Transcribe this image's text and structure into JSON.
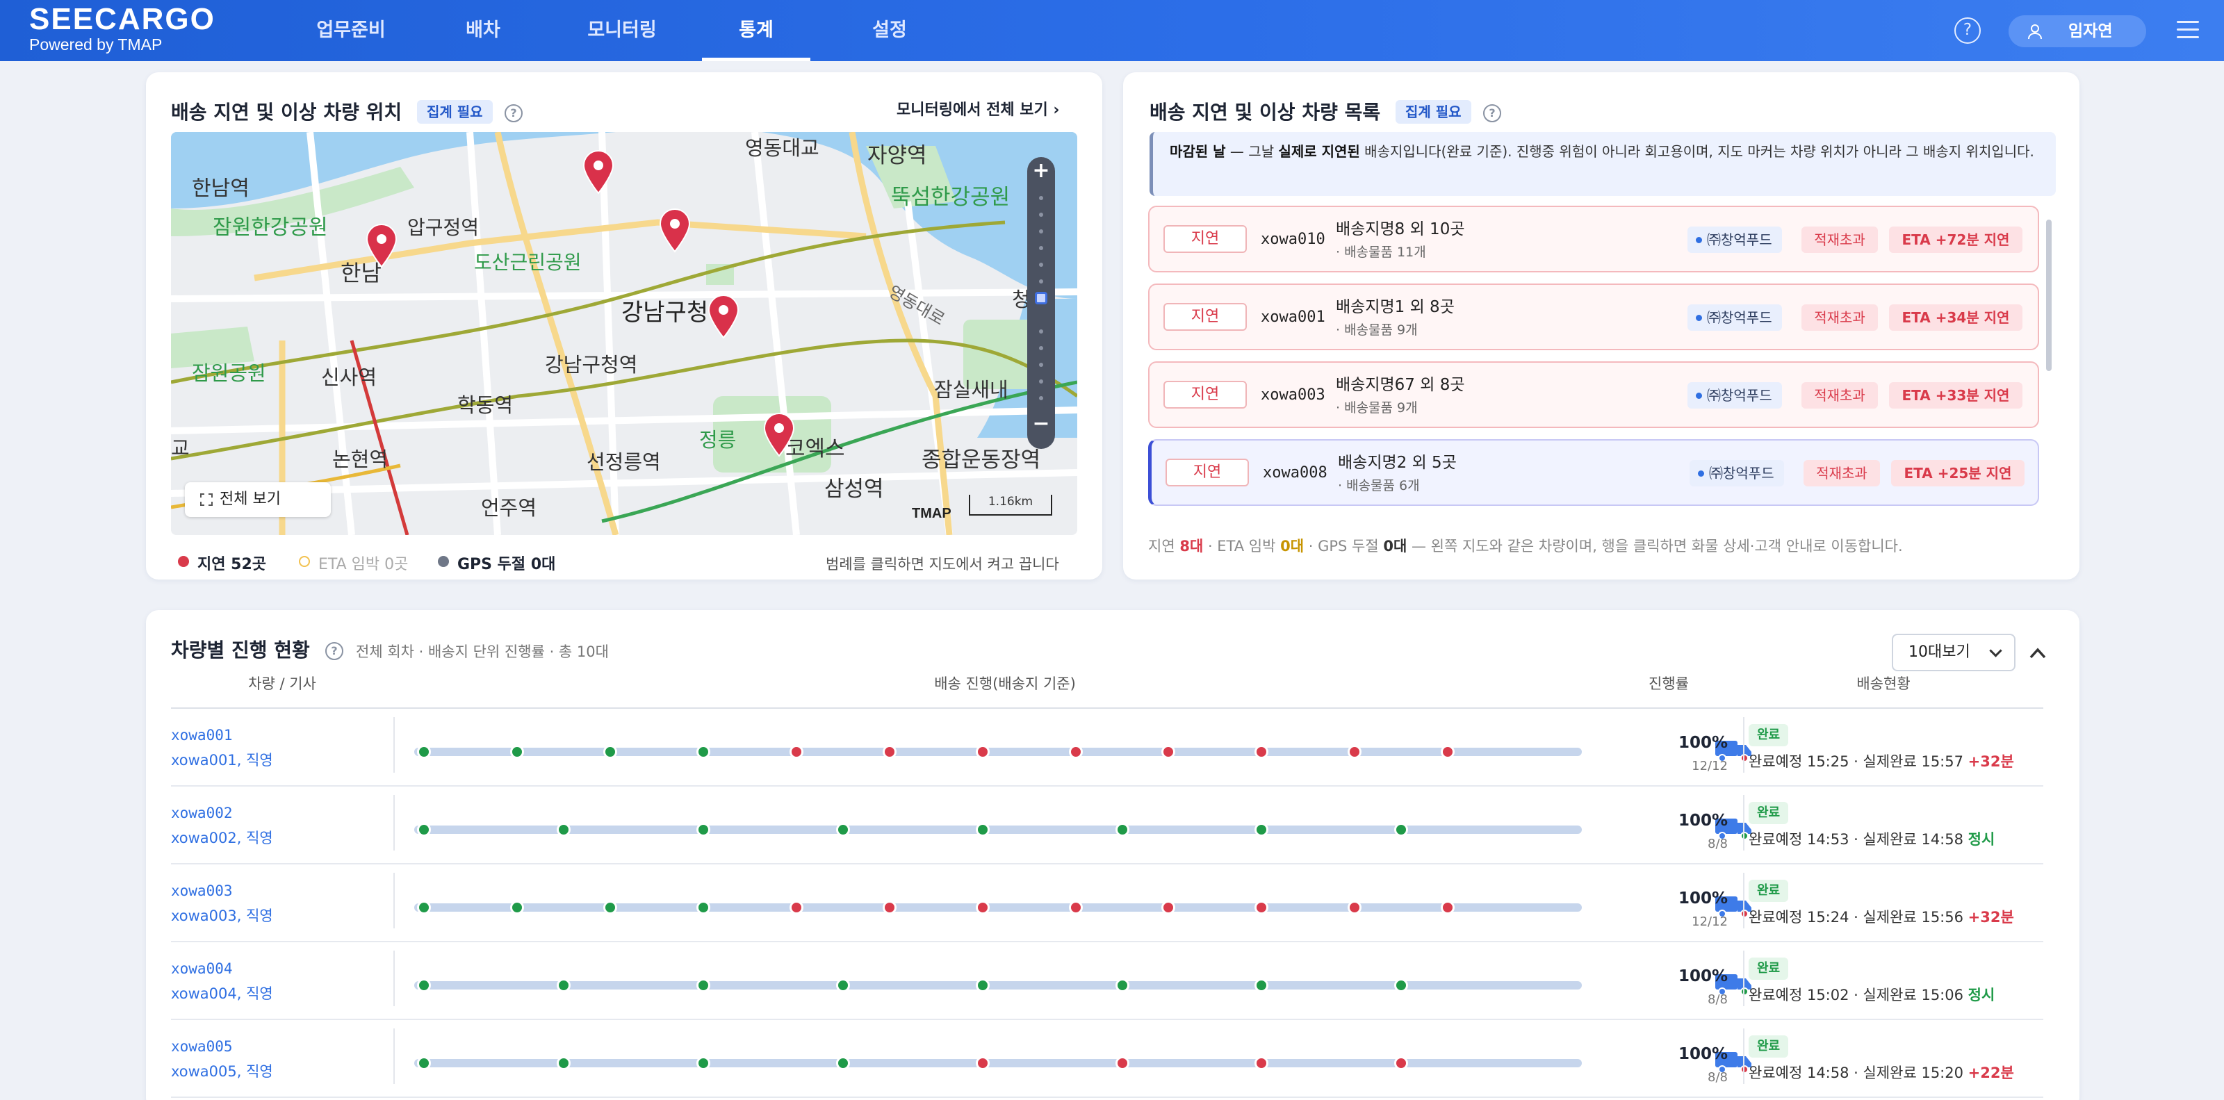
{
  "brand": {
    "logo": "SEECARGO",
    "sub": "Powered by TMAP"
  },
  "nav": [
    "업무준비",
    "배차",
    "모니터링",
    "통계",
    "설정"
  ],
  "nav_active": 3,
  "user": {
    "name": "임자연"
  },
  "map_card": {
    "title": "배송 지연 및 이상 차량 위치",
    "badge": "집계 필요",
    "link": "모니터링에서 전체 보기 ›",
    "fullview_label": "전체 보기",
    "tmap": "TMAP",
    "scale": "1.16km",
    "legend": [
      {
        "label": "지연 52곳",
        "color": "#d93a4a"
      },
      {
        "label": "ETA 임박 0곳",
        "color": "#f2c14e"
      },
      {
        "label": "GPS 두절 0대",
        "color": "#6f7787"
      }
    ],
    "legend_hint": "범례를 클릭하면 지도에서 켜고 끕니다",
    "place_labels": [
      "한남역",
      "잠원한강공원",
      "압구정역",
      "한남",
      "도산근린공원",
      "신사역",
      "잠원공원",
      "학동역",
      "논현역",
      "강남구청",
      "강남구청역",
      "선정릉역",
      "언주역",
      "정릉",
      "코엑스",
      "삼성역",
      "영동대교",
      "자양역",
      "뚝섬한강공원",
      "종합운동장역",
      "잠실새내",
      "영동대로",
      "교",
      "청담"
    ]
  },
  "list_card": {
    "title": "배송 지연 및 이상 차량 목록",
    "badge": "집계 필요",
    "notice_bold1": "마감된 날",
    "notice_mid": " — 그날 ",
    "notice_bold2": "실제로 지연된",
    "notice_rest": " 배송지입니다(완료 기준). 진행중 위험이 아니라 회고용이며, 지도 마커는 차량 위치가 아니라 그 배송지 위치입니다.",
    "rows": [
      {
        "tag": "지연",
        "id": "xowa010",
        "dest": "배송지명8 외 10곳",
        "sub": "· 배송물품 11개",
        "company": "㈜창억푸드",
        "flag": "적재초과",
        "eta": "ETA +72분 지연",
        "selected": false
      },
      {
        "tag": "지연",
        "id": "xowa001",
        "dest": "배송지명1 외 8곳",
        "sub": "· 배송물품 9개",
        "company": "㈜창억푸드",
        "flag": "적재초과",
        "eta": "ETA +34분 지연",
        "selected": false
      },
      {
        "tag": "지연",
        "id": "xowa003",
        "dest": "배송지명67 외 8곳",
        "sub": "· 배송물품 9개",
        "company": "㈜창억푸드",
        "flag": "적재초과",
        "eta": "ETA +33분 지연",
        "selected": false
      },
      {
        "tag": "지연",
        "id": "xowa008",
        "dest": "배송지명2 외 5곳",
        "sub": "· 배송물품 6개",
        "company": "㈜창억푸드",
        "flag": "적재초과",
        "eta": "ETA +25분 지연",
        "selected": true
      }
    ],
    "summary": {
      "p1": "지연 ",
      "delay": "8대",
      "p2": " · ETA 임박 ",
      "eta": "0대",
      "p3": " · GPS 두절 ",
      "gps": "0대",
      "p4": " — 왼쪽 지도와 같은 차량이며, 행을 클릭하면 화물 상세·고객 안내로 이동합니다."
    }
  },
  "progress": {
    "title": "차량별 진행 현황",
    "subtitle": "전체 회차 · 배송지 단위 진행률 · 총 10대",
    "select": "10대보기",
    "headers": [
      "차량 / 기사",
      "배송 진행(배송지 기준)",
      "진행률",
      "배송현황"
    ],
    "rows": [
      {
        "name": "xowa001",
        "driver": "xowa001, 직영",
        "pct": "100%",
        "count": "12/12",
        "status": "완료",
        "detail": "완료예정 15:25 · 실제완료 15:57 ",
        "result": "+32분",
        "late": true,
        "stops": [
          "g",
          "g",
          "g",
          "g",
          "r",
          "r",
          "r",
          "r",
          "r",
          "r",
          "r",
          "r"
        ]
      },
      {
        "name": "xowa002",
        "driver": "xowa002, 직영",
        "pct": "100%",
        "count": "8/8",
        "status": "완료",
        "detail": "완료예정 14:53 · 실제완료 14:58 ",
        "result": "정시",
        "late": false,
        "stops": [
          "g",
          "g",
          "g",
          "g",
          "g",
          "g",
          "g",
          "g"
        ]
      },
      {
        "name": "xowa003",
        "driver": "xowa003, 직영",
        "pct": "100%",
        "count": "12/12",
        "status": "완료",
        "detail": "완료예정 15:24 · 실제완료 15:56 ",
        "result": "+32분",
        "late": true,
        "stops": [
          "g",
          "g",
          "g",
          "g",
          "r",
          "r",
          "r",
          "r",
          "r",
          "r",
          "r",
          "r"
        ]
      },
      {
        "name": "xowa004",
        "driver": "xowa004, 직영",
        "pct": "100%",
        "count": "8/8",
        "status": "완료",
        "detail": "완료예정 15:02 · 실제완료 15:06 ",
        "result": "정시",
        "late": false,
        "stops": [
          "g",
          "g",
          "g",
          "g",
          "g",
          "g",
          "g",
          "g"
        ]
      },
      {
        "name": "xowa005",
        "driver": "xowa005, 직영",
        "pct": "100%",
        "count": "8/8",
        "status": "완료",
        "detail": "완료예정 14:58 · 실제완료 15:20 ",
        "result": "+22분",
        "late": true,
        "stops": [
          "g",
          "g",
          "g",
          "g",
          "r",
          "r",
          "r",
          "r"
        ]
      }
    ]
  },
  "colors": {
    "primary": "#2c6ee8",
    "red": "#d93a4a",
    "green": "#1f9a48",
    "track": "#c6d5ec"
  }
}
